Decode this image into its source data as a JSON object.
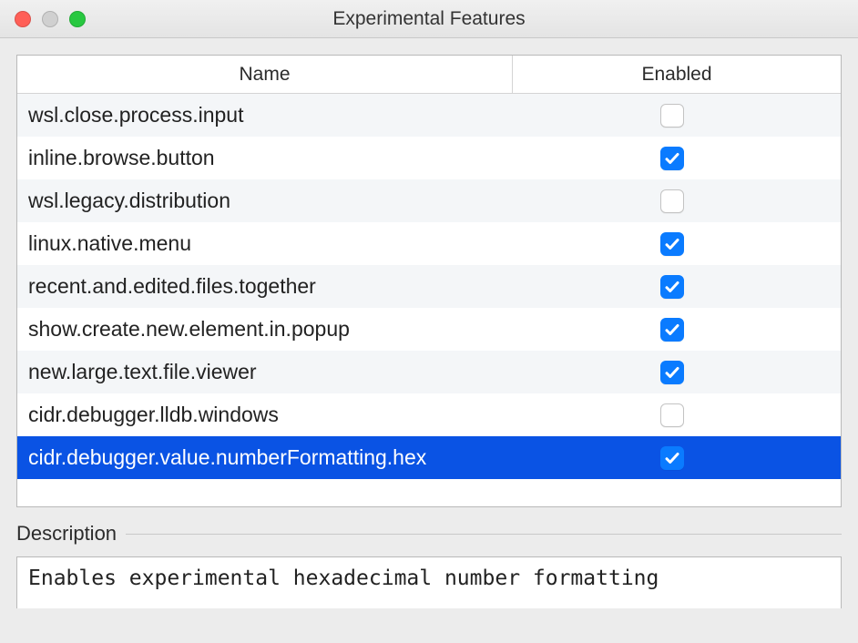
{
  "window": {
    "title": "Experimental Features"
  },
  "table": {
    "headers": {
      "name": "Name",
      "enabled": "Enabled"
    },
    "rows": [
      {
        "name": "wsl.close.process.input",
        "enabled": false,
        "selected": false
      },
      {
        "name": "inline.browse.button",
        "enabled": true,
        "selected": false
      },
      {
        "name": "wsl.legacy.distribution",
        "enabled": false,
        "selected": false
      },
      {
        "name": "linux.native.menu",
        "enabled": true,
        "selected": false
      },
      {
        "name": "recent.and.edited.files.together",
        "enabled": true,
        "selected": false
      },
      {
        "name": "show.create.new.element.in.popup",
        "enabled": true,
        "selected": false
      },
      {
        "name": "new.large.text.file.viewer",
        "enabled": true,
        "selected": false
      },
      {
        "name": "cidr.debugger.lldb.windows",
        "enabled": false,
        "selected": false
      },
      {
        "name": "cidr.debugger.value.numberFormatting.hex",
        "enabled": true,
        "selected": true
      }
    ]
  },
  "description": {
    "label": "Description",
    "text": "Enables experimental hexadecimal number formatting"
  }
}
